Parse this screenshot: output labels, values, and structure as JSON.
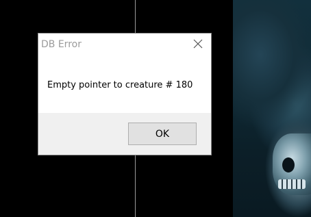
{
  "dialog": {
    "title": "DB Error",
    "message": "Empty pointer to creature # 180",
    "ok_label": "OK"
  },
  "icons": {
    "close": "close-icon"
  },
  "colors": {
    "background": "#000000",
    "dialog_body": "#ffffff",
    "button_bar": "#f0f0f0",
    "title_text": "#9b9b9b"
  }
}
